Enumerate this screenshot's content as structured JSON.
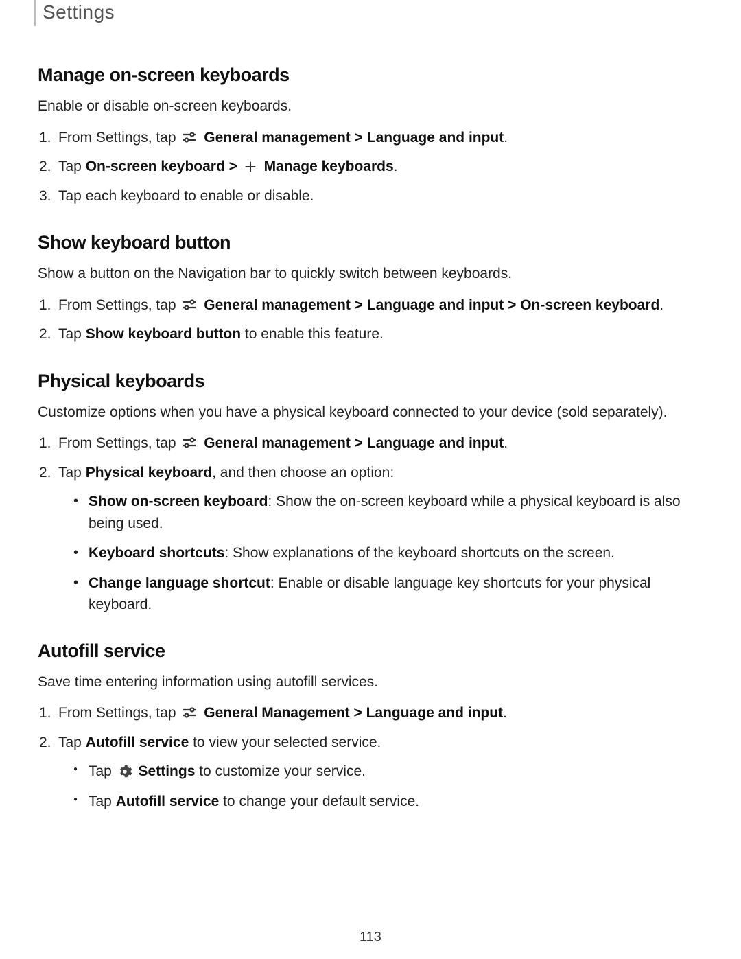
{
  "header": {
    "title": "Settings"
  },
  "page_number": "113",
  "sections": {
    "manage": {
      "title": "Manage on-screen keyboards",
      "intro": "Enable or disable on-screen keyboards.",
      "step1_a": "From Settings, tap ",
      "step1_b": " General management",
      "step1_c": " > ",
      "step1_d": "Language and input",
      "step1_e": ".",
      "step2_a": "Tap ",
      "step2_b": "On-screen keyboard",
      "step2_c": " > ",
      "step2_d": " Manage keyboards",
      "step2_e": ".",
      "step3": "Tap each keyboard to enable or disable."
    },
    "showkb": {
      "title": "Show keyboard button",
      "intro": "Show a button on the Navigation bar to quickly switch between keyboards.",
      "step1_a": "From Settings, tap ",
      "step1_b": " General management",
      "step1_c": " > ",
      "step1_d": "Language and input",
      "step1_e": " > ",
      "step1_f": "On-screen keyboard",
      "step1_g": ".",
      "step2_a": "Tap ",
      "step2_b": "Show keyboard button",
      "step2_c": " to enable this feature."
    },
    "physical": {
      "title": "Physical keyboards",
      "intro": "Customize options when you have a physical keyboard connected to your device (sold separately).",
      "step1_a": "From Settings, tap ",
      "step1_b": " General management",
      "step1_c": " > ",
      "step1_d": "Language and input",
      "step1_e": ".",
      "step2_a": "Tap ",
      "step2_b": "Physical keyboard",
      "step2_c": ", and then choose an option:",
      "bullets": {
        "b1a": "Show on-screen keyboard",
        "b1b": ": Show the on-screen keyboard while a physical keyboard is also being used.",
        "b2a": "Keyboard shortcuts",
        "b2b": ": Show explanations of the keyboard shortcuts on the screen.",
        "b3a": "Change language shortcut",
        "b3b": ": Enable or disable language key shortcuts for your physical keyboard."
      }
    },
    "autofill": {
      "title": "Autofill service",
      "intro": "Save time entering information using autofill services.",
      "step1_a": "From Settings, tap ",
      "step1_b": " General Management",
      "step1_c": " > ",
      "step1_d": "Language and input",
      "step1_e": ".",
      "step2_a": "Tap ",
      "step2_b": "Autofill service",
      "step2_c": " to view your selected service.",
      "bullets": {
        "b1a": "Tap ",
        "b1b": " Settings",
        "b1c": " to customize your service.",
        "b2a": "Tap ",
        "b2b": "Autofill service",
        "b2c": " to change your default service."
      }
    }
  }
}
